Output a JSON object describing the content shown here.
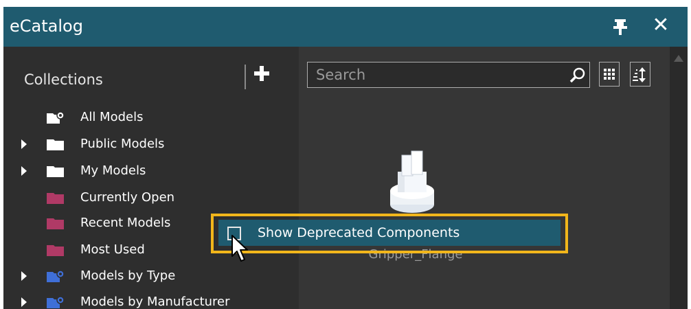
{
  "window": {
    "title": "eCatalog",
    "close_glyph": "✕"
  },
  "sidebar": {
    "header": "Collections",
    "items": [
      {
        "label": "All Models",
        "icon": "folder-gear-icon",
        "expandable": false,
        "color": "#ffffff"
      },
      {
        "label": "Public Models",
        "icon": "folder-icon",
        "expandable": true,
        "color": "#ffffff"
      },
      {
        "label": "My Models",
        "icon": "folder-icon",
        "expandable": true,
        "color": "#ffffff"
      },
      {
        "label": "Currently Open",
        "icon": "folder-icon",
        "expandable": false,
        "color": "#b03a66"
      },
      {
        "label": "Recent Models",
        "icon": "folder-icon",
        "expandable": false,
        "color": "#b03a66"
      },
      {
        "label": "Most Used",
        "icon": "folder-icon",
        "expandable": false,
        "color": "#b03a66"
      },
      {
        "label": "Models by Type",
        "icon": "folder-gear-icon",
        "expandable": true,
        "color": "#3f6fd8"
      },
      {
        "label": "Models by Manufacturer",
        "icon": "folder-gear-icon",
        "expandable": true,
        "color": "#3f6fd8"
      }
    ]
  },
  "search": {
    "placeholder": "Search"
  },
  "main": {
    "model_caption": "Gripper_Flange"
  },
  "context_menu": {
    "items": [
      {
        "label": "Show Deprecated Components",
        "checked": false
      }
    ]
  },
  "colors": {
    "titlebar": "#1f5b6f",
    "highlight_border": "#f2b61b"
  }
}
